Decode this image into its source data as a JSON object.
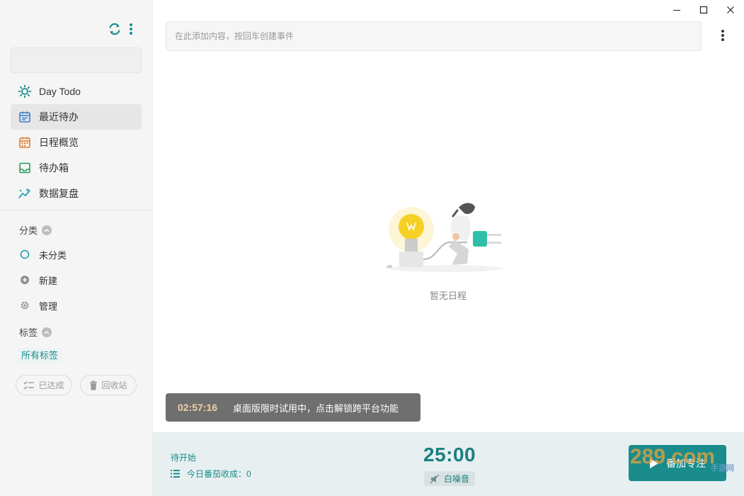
{
  "sidebar": {
    "nav": [
      {
        "label": "Day Todo",
        "icon": "sun-icon"
      },
      {
        "label": "最近待办",
        "icon": "calendar-icon",
        "active": true
      },
      {
        "label": "日程概览",
        "icon": "calendar-grid-icon"
      },
      {
        "label": "待办箱",
        "icon": "inbox-icon"
      },
      {
        "label": "数据复盘",
        "icon": "sparkle-chart-icon"
      }
    ],
    "categories_title": "分类",
    "categories": [
      {
        "label": "未分类",
        "icon": "circle-outline-icon"
      },
      {
        "label": "新建",
        "icon": "plus-circle-icon"
      },
      {
        "label": "管理",
        "icon": "gear-icon"
      }
    ],
    "tags_title": "标签",
    "all_tags": "所有标签",
    "done_label": "已达成",
    "trash_label": "回收站"
  },
  "main": {
    "add_placeholder": "在此添加内容，按回车创建事件",
    "empty_text": "暂无日程"
  },
  "toast": {
    "time": "02:57:16",
    "message": "桌面版限时试用中，点击解锁跨平台功能"
  },
  "bottom": {
    "status": "待开始",
    "today_count": "今日番茄收成：0",
    "timer": "25:00",
    "noise": "白噪音",
    "focus_button": "番加专注"
  },
  "watermark": {
    "text": "289.com",
    "sub": "手游网"
  },
  "colors": {
    "accent": "#1a8c8c",
    "sidebar_bg": "#f5f5f5",
    "toast_bg": "#6f6f6f",
    "toast_time": "#f2d1a7",
    "bottom_bg": "#e7eff0"
  }
}
